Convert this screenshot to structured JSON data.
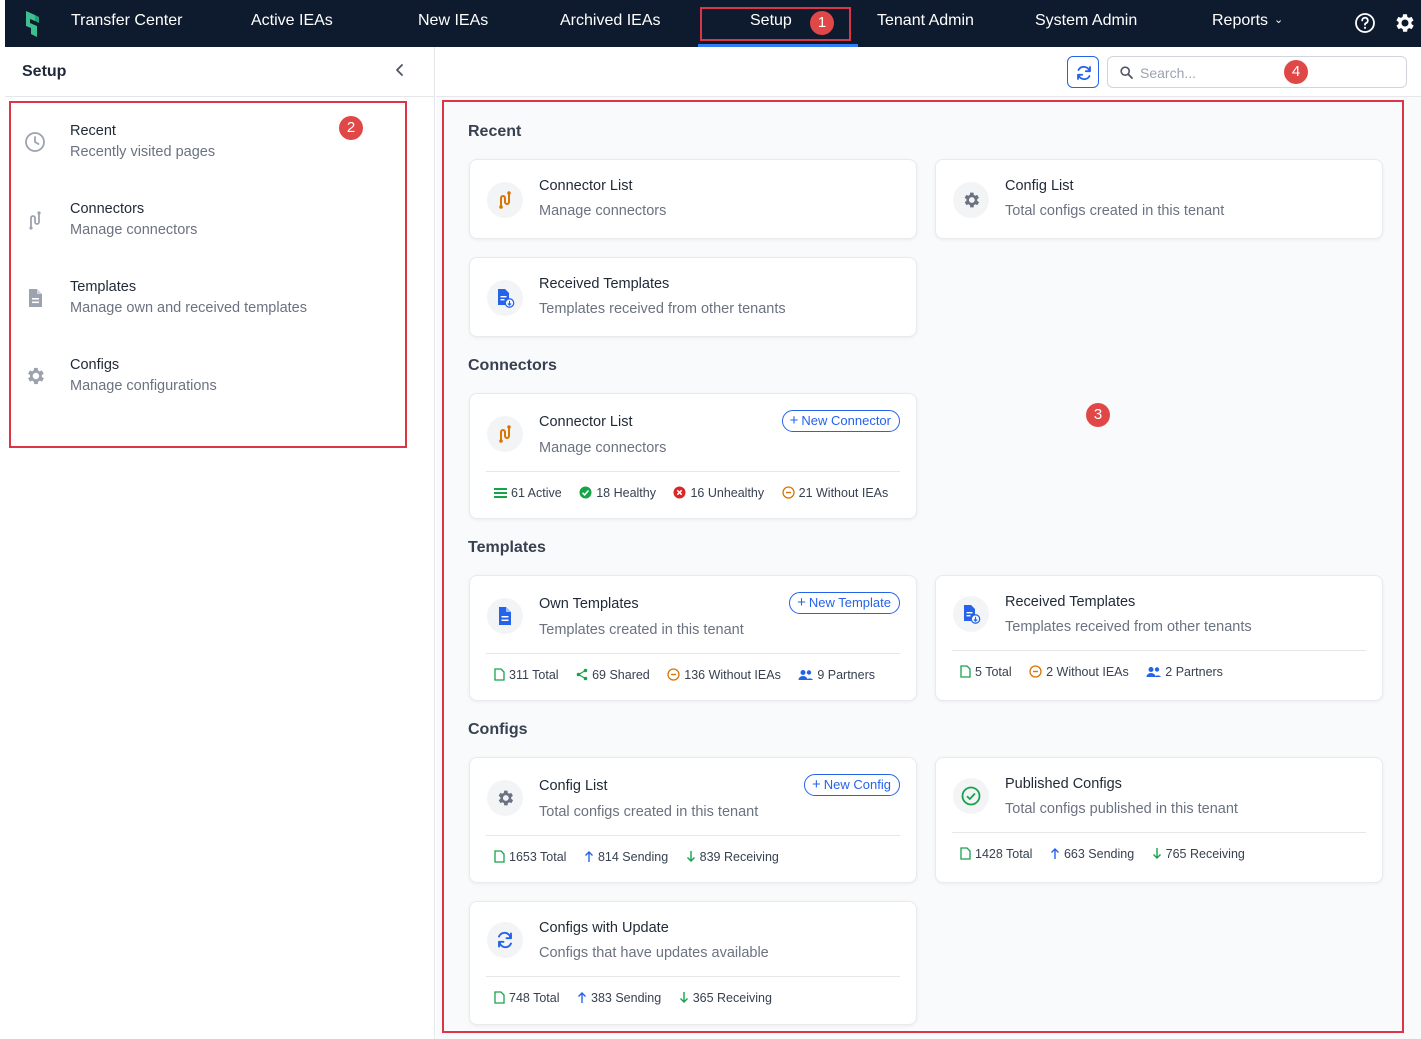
{
  "nav": {
    "items": [
      "Transfer Center",
      "Active IEAs",
      "New IEAs",
      "Archived IEAs",
      "Setup",
      "Tenant Admin",
      "System Admin",
      "Reports"
    ],
    "active": "Setup",
    "help_icon": "help-circle-icon",
    "settings_icon": "gear-icon"
  },
  "sidebar": {
    "title": "Setup",
    "items": [
      {
        "icon": "clock-icon",
        "title": "Recent",
        "subtitle": "Recently visited pages"
      },
      {
        "icon": "connector-icon",
        "title": "Connectors",
        "subtitle": "Manage connectors"
      },
      {
        "icon": "document-icon",
        "title": "Templates",
        "subtitle": "Manage own and received templates"
      },
      {
        "icon": "gear-icon",
        "title": "Configs",
        "subtitle": "Manage configurations"
      }
    ]
  },
  "toolbar": {
    "search_placeholder": "Search..."
  },
  "sections": {
    "recent": {
      "title": "Recent",
      "cards": [
        {
          "title": "Connector List",
          "subtitle": "Manage connectors"
        },
        {
          "title": "Config List",
          "subtitle": "Total configs created in this tenant"
        },
        {
          "title": "Received Templates",
          "subtitle": "Templates received from other tenants"
        }
      ]
    },
    "connectors": {
      "title": "Connectors",
      "card": {
        "title": "Connector List",
        "subtitle": "Manage connectors",
        "button": "New Connector",
        "stats": [
          "61 Active",
          "18 Healthy",
          "16 Unhealthy",
          "21 Without IEAs"
        ]
      }
    },
    "templates": {
      "title": "Templates",
      "own": {
        "title": "Own Templates",
        "subtitle": "Templates created in this tenant",
        "button": "New Template",
        "stats": [
          "311 Total",
          "69 Shared",
          "136 Without IEAs",
          "9 Partners"
        ]
      },
      "received": {
        "title": "Received Templates",
        "subtitle": "Templates received from other tenants",
        "stats": [
          "5 Total",
          "2 Without IEAs",
          "2 Partners"
        ]
      }
    },
    "configs": {
      "title": "Configs",
      "list": {
        "title": "Config List",
        "subtitle": "Total configs created in this tenant",
        "button": "New Config",
        "stats": [
          "1653 Total",
          "814 Sending",
          "839 Receiving"
        ]
      },
      "published": {
        "title": "Published Configs",
        "subtitle": "Total configs published in this tenant",
        "stats": [
          "1428 Total",
          "663 Sending",
          "765 Receiving"
        ]
      },
      "updates": {
        "title": "Configs with Update",
        "subtitle": "Configs that have updates available",
        "stats": [
          "748 Total",
          "383 Sending",
          "365 Receiving"
        ]
      }
    }
  },
  "annotations": [
    "1",
    "2",
    "3",
    "4"
  ],
  "colors": {
    "nav_bg": "#0e1a2e",
    "accent": "#2563eb",
    "annotation": "#dc3545",
    "connector_orange": "#d97706",
    "success_green": "#16a34a",
    "error_red": "#dc2626"
  }
}
